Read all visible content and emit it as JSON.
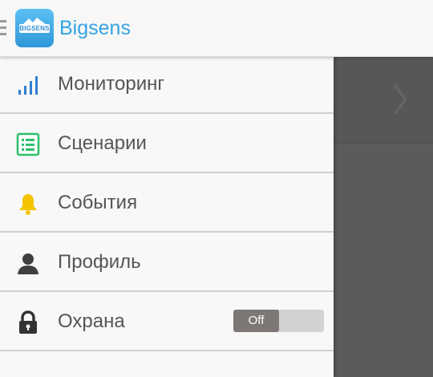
{
  "app": {
    "title": "Bigsens",
    "logo_text": "BIGSENS",
    "accent": "#33a4e4"
  },
  "drawer": {
    "items": [
      {
        "label": "Мониторинг",
        "icon": "signal-bars-icon"
      },
      {
        "label": "Сценарии",
        "icon": "list-icon"
      },
      {
        "label": "События",
        "icon": "bell-icon"
      },
      {
        "label": "Профиль",
        "icon": "user-icon"
      },
      {
        "label": "Охрана",
        "icon": "lock-icon",
        "toggle": {
          "state_label": "Off",
          "on": false
        }
      }
    ]
  }
}
